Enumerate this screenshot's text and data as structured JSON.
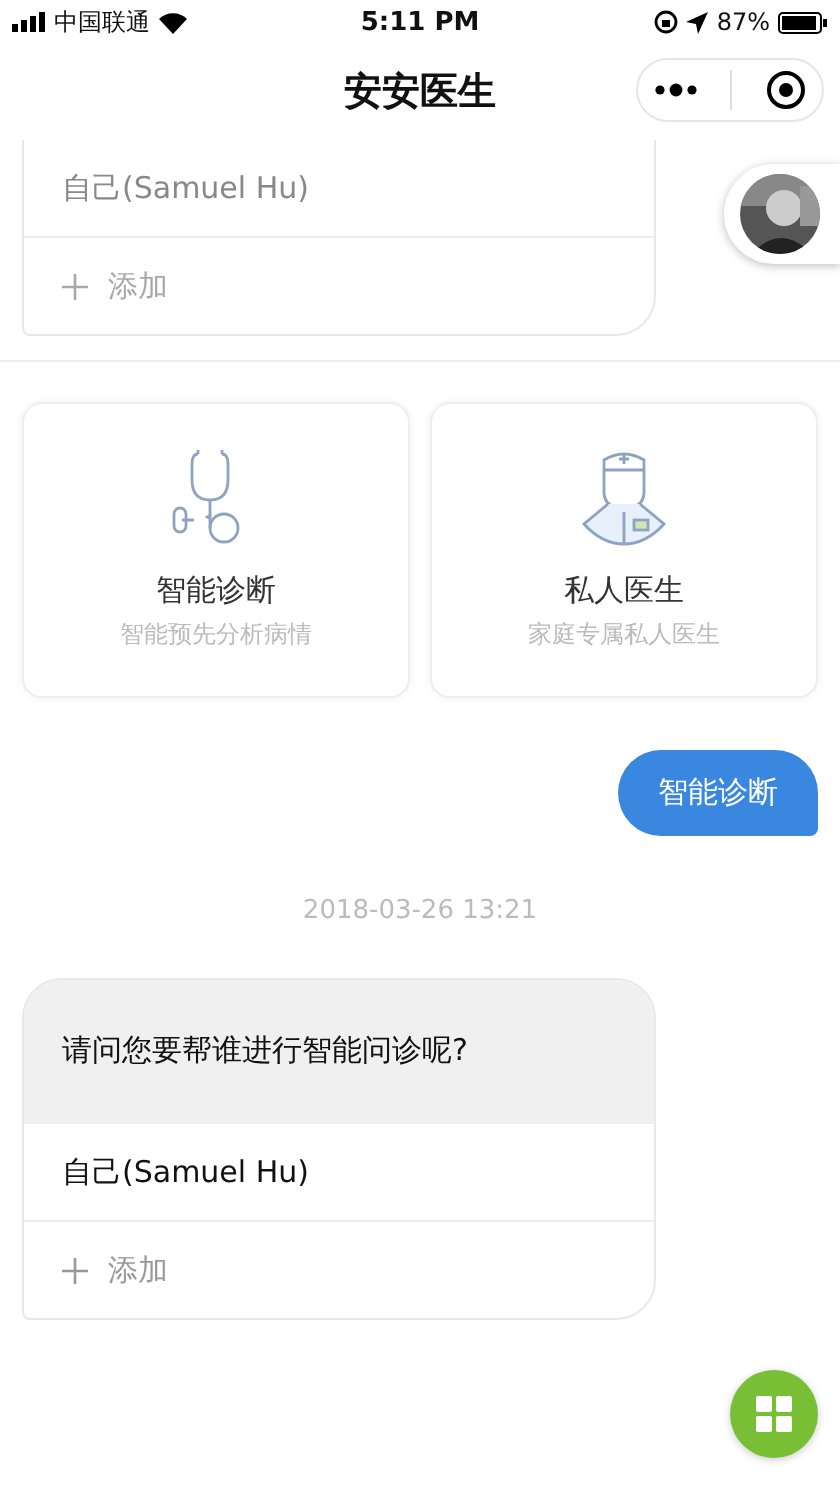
{
  "status_bar": {
    "carrier": "中国联通",
    "time": "5:11 PM",
    "battery": "87%"
  },
  "nav": {
    "title": "安安医生"
  },
  "messages": [
    {
      "kind": "choice",
      "disabled": true,
      "options": [
        {
          "kind": "person",
          "label": "自己(Samuel Hu)"
        },
        {
          "kind": "add",
          "label": "添加"
        }
      ]
    },
    {
      "kind": "services",
      "items": [
        {
          "kind": "stethoscope",
          "title": "智能诊断",
          "subtitle": "智能预先分析病情"
        },
        {
          "kind": "doctor",
          "title": "私人医生",
          "subtitle": "家庭专属私人医生"
        }
      ]
    },
    {
      "kind": "user",
      "text": "智能诊断"
    },
    {
      "kind": "time",
      "text": "2018-03-26 13:21"
    },
    {
      "kind": "choice",
      "disabled": false,
      "question": "请问您要帮谁进行智能问诊呢?",
      "options": [
        {
          "kind": "person",
          "label": "自己(Samuel Hu)"
        },
        {
          "kind": "add",
          "label": "添加"
        }
      ]
    }
  ]
}
